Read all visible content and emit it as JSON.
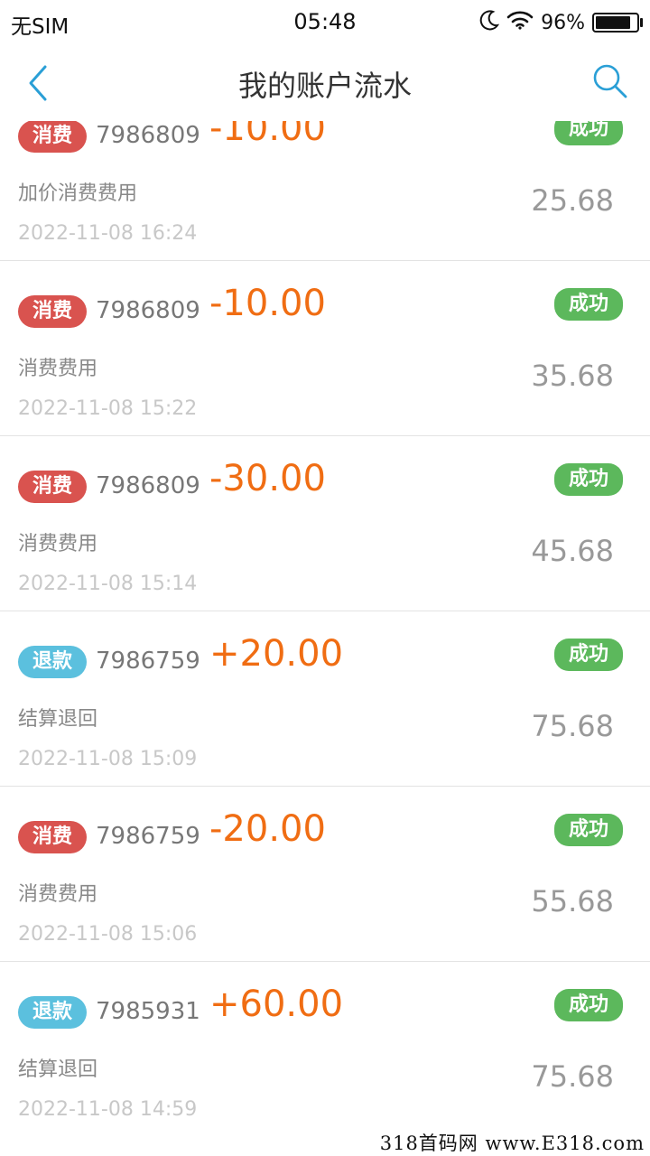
{
  "status_bar": {
    "carrier": "无SIM",
    "time": "05:48",
    "battery_pct": "96%",
    "battery_level": 0.96
  },
  "nav": {
    "title": "我的账户流水"
  },
  "records": [
    {
      "type": "消费",
      "kind": "spend",
      "order": "7986809",
      "amount": "-10.00",
      "status": "成功",
      "desc": "加价消费费用",
      "balance": "25.68",
      "time": "2022-11-08 16:24"
    },
    {
      "type": "消费",
      "kind": "spend",
      "order": "7986809",
      "amount": "-10.00",
      "status": "成功",
      "desc": "消费费用",
      "balance": "35.68",
      "time": "2022-11-08 15:22"
    },
    {
      "type": "消费",
      "kind": "spend",
      "order": "7986809",
      "amount": "-30.00",
      "status": "成功",
      "desc": "消费费用",
      "balance": "45.68",
      "time": "2022-11-08 15:14"
    },
    {
      "type": "退款",
      "kind": "refund",
      "order": "7986759",
      "amount": "+20.00",
      "status": "成功",
      "desc": "结算退回",
      "balance": "75.68",
      "time": "2022-11-08 15:09"
    },
    {
      "type": "消费",
      "kind": "spend",
      "order": "7986759",
      "amount": "-20.00",
      "status": "成功",
      "desc": "消费费用",
      "balance": "55.68",
      "time": "2022-11-08 15:06"
    },
    {
      "type": "退款",
      "kind": "refund",
      "order": "7985931",
      "amount": "+60.00",
      "status": "成功",
      "desc": "结算退回",
      "balance": "75.68",
      "time": "2022-11-08 14:59"
    }
  ],
  "watermark": "318首码网 www.E318.com",
  "colors": {
    "spend_badge": "#d9534f",
    "refund_badge": "#5bc0de",
    "success": "#5cb85c",
    "amount": "#f06d13",
    "accent": "#2a9fd6"
  }
}
